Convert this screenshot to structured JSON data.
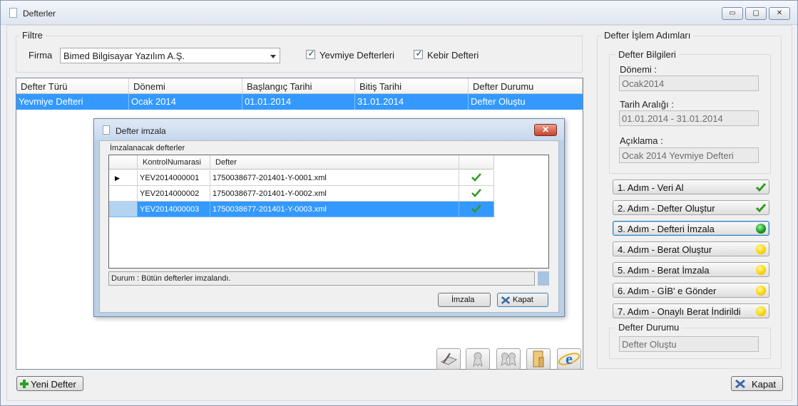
{
  "window": {
    "title": "Defterler",
    "min_glyph": "▭",
    "max_glyph": "▢",
    "close_glyph": "✕"
  },
  "filter": {
    "group_label": "Filtre",
    "firma_label": "Firma",
    "firma_value": "Bimed Bilgisayar Yazılım A.Ş.",
    "yevmiye_label": "Yevmiye Defterleri",
    "yevmiye_checked": true,
    "kebir_label": "Kebir Defteri",
    "kebir_checked": true,
    "check_glyph": "✓"
  },
  "main_grid": {
    "columns": [
      "Defter Türü",
      "Dönemi",
      "Başlangıç Tarihi",
      "Bitiş Tarihi",
      "Defter Durumu"
    ],
    "rows": [
      [
        "Yevmiye Defteri",
        "Ocak 2014",
        "01.01.2014",
        "31.01.2014",
        "Defter Oluştu"
      ]
    ]
  },
  "dialog": {
    "title": "Defter imzala",
    "close_glyph": "✕",
    "section_label": "İmzalanacak defterler",
    "columns": [
      "KontrolNumarasi",
      "Defter"
    ],
    "rows": [
      {
        "indicator": "▶",
        "kontrol": "YEV2014000001",
        "defter": "1750038677-201401-Y-0001.xml",
        "signed": true,
        "selected": false
      },
      {
        "indicator": "",
        "kontrol": "YEV2014000002",
        "defter": "1750038677-201401-Y-0002.xml",
        "signed": true,
        "selected": false
      },
      {
        "indicator": "",
        "kontrol": "YEV2014000003",
        "defter": "1750038677-201401-Y-0003.xml",
        "signed": true,
        "selected": true
      }
    ],
    "status": "Durum : Bütün defterler imzalandı.",
    "sign_button": "İmzala",
    "close_button": "Kapat"
  },
  "steps_panel": {
    "group_label": "Defter İşlem Adımları",
    "info_group_label": "Defter Bilgileri",
    "donemi_label": "Dönemi :",
    "donemi_value": "Ocak2014",
    "tarih_label": "Tarih Aralığı :",
    "tarih_value": "01.01.2014 - 31.01.2014",
    "aciklama_label": "Açıklama :",
    "aciklama_value": "Ocak 2014 Yevmiye Defteri",
    "steps": [
      {
        "label": "1. Adım - Veri Al",
        "status": "done"
      },
      {
        "label": "2. Adım - Defter Oluştur",
        "status": "done"
      },
      {
        "label": "3. Adım - Defteri İmzala",
        "status": "active"
      },
      {
        "label": "4. Adım - Berat Oluştur",
        "status": "pending"
      },
      {
        "label": "5. Adım - Berat İmzala",
        "status": "pending"
      },
      {
        "label": "6. Adım - GİB' e Gönder",
        "status": "pending"
      },
      {
        "label": "7. Adım - Onaylı Berat İndirildi",
        "status": "pending"
      }
    ],
    "durum_group_label": "Defter Durumu",
    "durum_value": "Defter Oluştu"
  },
  "bottom": {
    "new_button": "Yeni Defter",
    "close_button": "Kapat",
    "toolbar_icons": [
      "book-sign-icon",
      "ribbon-icon",
      "double-ribbon-icon",
      "file-folder-icon",
      "internet-explorer-icon"
    ]
  },
  "colors": {
    "selection": "#3399ff",
    "check_green": "#2e9b1f",
    "accent": "#3c7fb1"
  }
}
